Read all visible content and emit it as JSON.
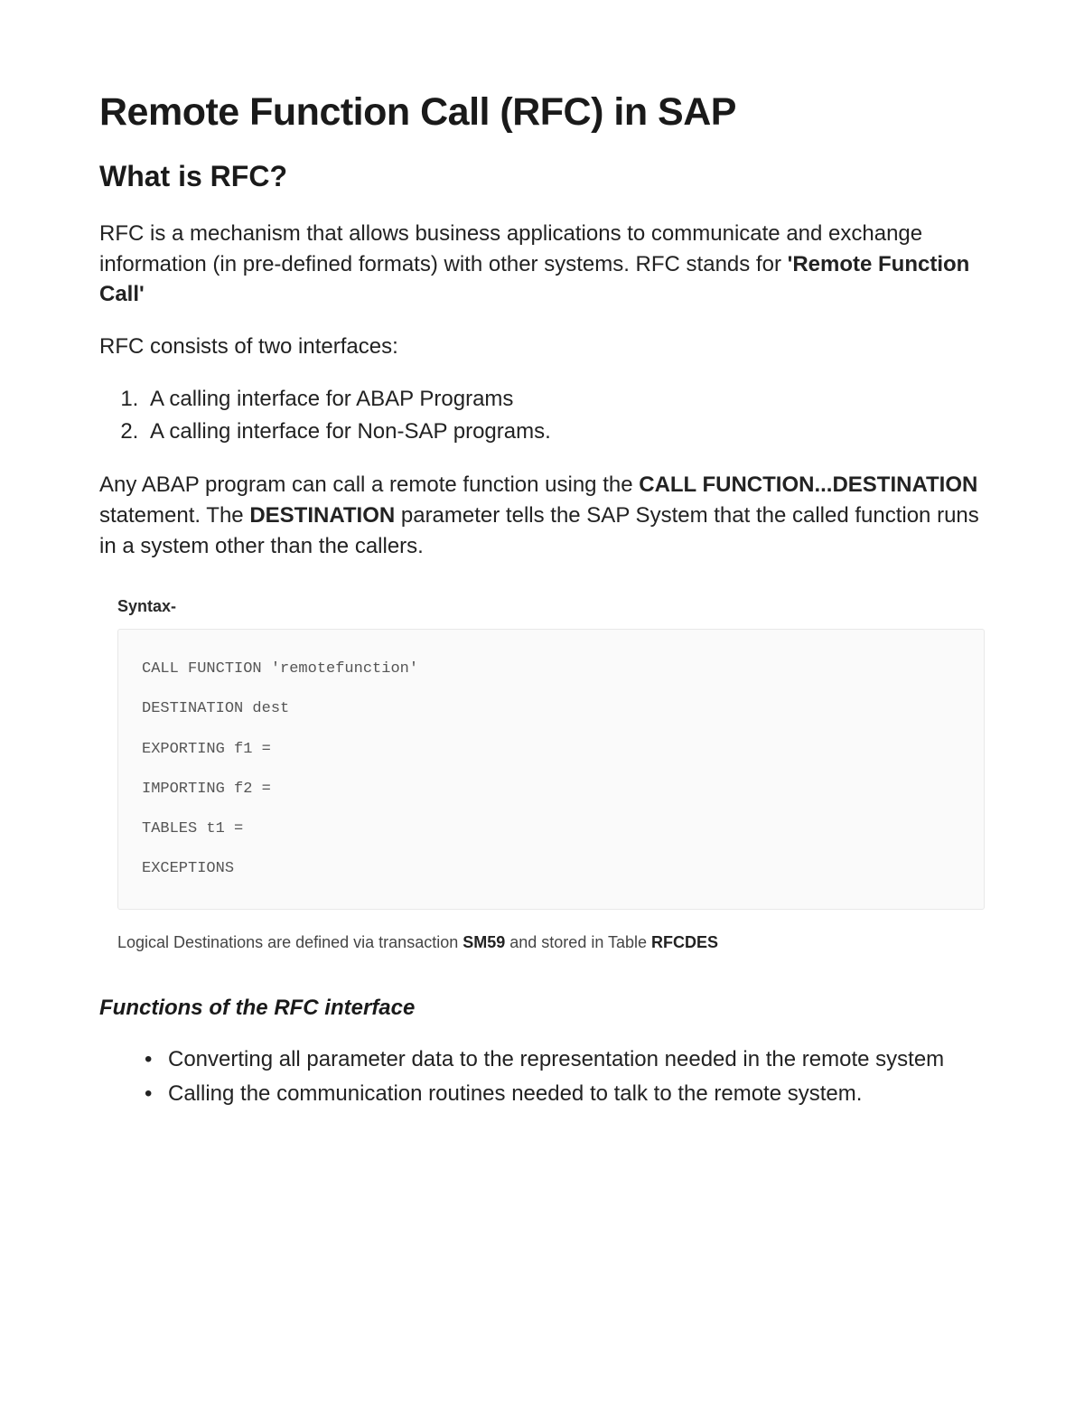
{
  "title": "Remote Function Call (RFC) in SAP",
  "section1": {
    "heading": "What is RFC?",
    "p1_pre": "RFC is a mechanism that allows business applications to communicate and exchange information (in pre-defined formats) with other systems. RFC stands for ",
    "p1_bold": "'Remote Function Call'",
    "p2": "RFC consists of two interfaces:",
    "list": {
      "item1": "A calling interface for ABAP Programs",
      "item2": "A calling interface for Non-SAP programs."
    },
    "p3_a": "Any ABAP program can call a remote function using the ",
    "p3_b": "CALL FUNCTION...DESTINATION",
    "p3_c": " statement. The ",
    "p3_d": "DESTINATION",
    "p3_e": " parameter tells the SAP System that the called function runs in a system other than the callers."
  },
  "syntax": {
    "label": "Syntax-",
    "lines": {
      "l1": "CALL FUNCTION 'remotefunction'",
      "l2": "DESTINATION dest",
      "l3": "EXPORTING f1 =",
      "l4": "IMPORTING f2 =",
      "l5": "TABLES t1 =",
      "l6": "EXCEPTIONS"
    }
  },
  "note": {
    "pre": "Logical Destinations are defined via transaction ",
    "b1": "SM59",
    "mid": " and stored in Table ",
    "b2": "RFCDES"
  },
  "section2": {
    "heading": "Functions of the RFC interface",
    "list": {
      "item1": "Converting all parameter data to the representation needed in the remote system",
      "item2": "Calling the communication routines needed to talk to the remote system."
    }
  }
}
